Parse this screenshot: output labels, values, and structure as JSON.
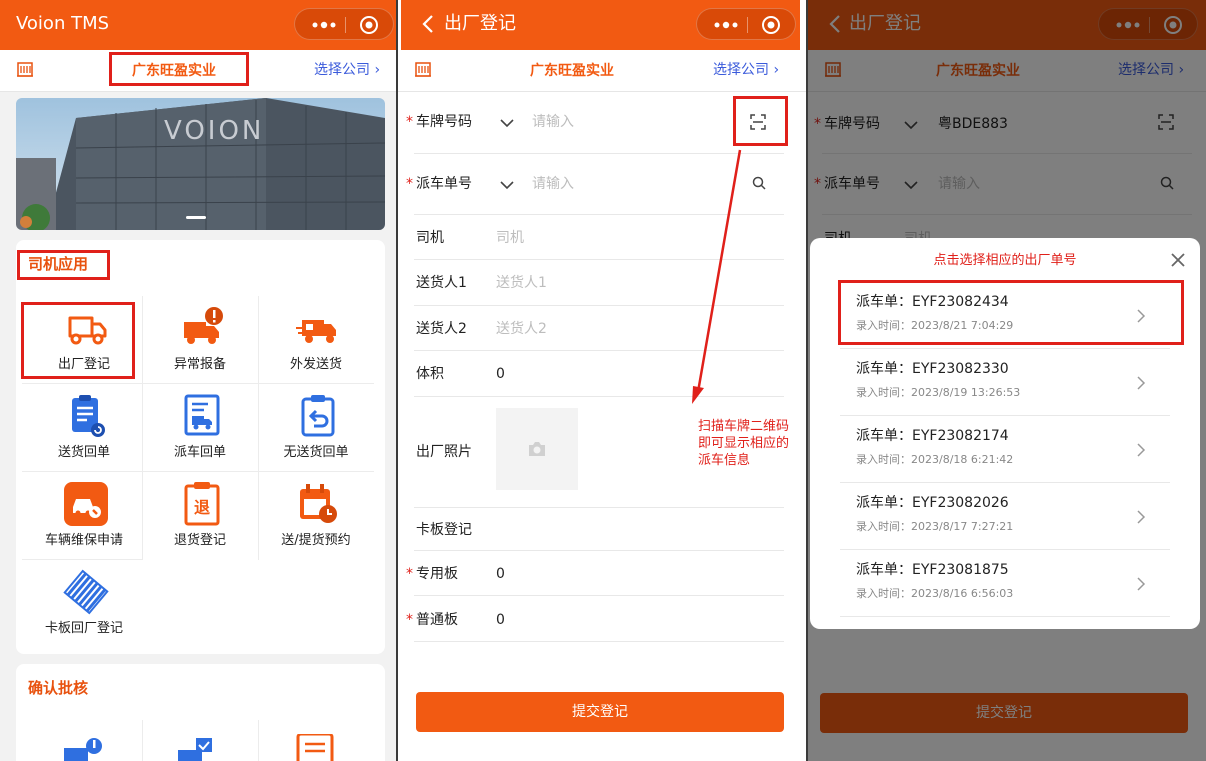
{
  "colors": {
    "brand": "#f25a12",
    "annotation": "#e0201a",
    "link": "#3b5bdb"
  },
  "screen1": {
    "app_title": "Voion TMS",
    "company": "广东旺盈实业",
    "select_company": "选择公司 ›",
    "banner_text": "VOION",
    "driver_section": "司机应用",
    "driver_apps": [
      {
        "label": "出厂登记",
        "icon": "truck-outline-icon"
      },
      {
        "label": "异常报备",
        "icon": "truck-alert-icon"
      },
      {
        "label": "外发送货",
        "icon": "truck-cargo-icon"
      },
      {
        "label": "送货回单",
        "icon": "clipboard-refresh-icon"
      },
      {
        "label": "派车回单",
        "icon": "document-truck-icon"
      },
      {
        "label": "无送货回单",
        "icon": "clipboard-return-icon"
      },
      {
        "label": "车辆维保申请",
        "icon": "car-repair-icon"
      },
      {
        "label": "退货登记",
        "icon": "return-document-icon"
      },
      {
        "label": "送/提货预约",
        "icon": "calendar-clock-icon"
      },
      {
        "label": "卡板回厂登记",
        "icon": "pallet-icon"
      }
    ],
    "confirm_section": "确认批核"
  },
  "screen2": {
    "title": "出厂登记",
    "company": "广东旺盈实业",
    "select_company": "选择公司 ›",
    "fields": {
      "plate": {
        "label": "车牌号码",
        "placeholder": "请输入"
      },
      "dispatch": {
        "label": "派车单号",
        "placeholder": "请输入"
      },
      "driver": {
        "label": "司机",
        "placeholder": "司机"
      },
      "sender1": {
        "label": "送货人1",
        "placeholder": "送货人1"
      },
      "sender2": {
        "label": "送货人2",
        "placeholder": "送货人2"
      },
      "volume": {
        "label": "体积",
        "value": "0"
      },
      "photo": {
        "label": "出厂照片"
      },
      "pallet_section": {
        "label": "卡板登记"
      },
      "special_pallet": {
        "label": "专用板",
        "value": "0"
      },
      "normal_pallet": {
        "label": "普通板",
        "value": "0"
      }
    },
    "submit": "提交登记",
    "annotation": [
      "扫描车牌二维码",
      "即可显示相应的",
      "派车信息"
    ]
  },
  "screen3": {
    "title": "出厂登记",
    "company": "广东旺盈实业",
    "select_company": "选择公司 ›",
    "plate_label": "车牌号码",
    "plate_value": "粤BDE883",
    "dispatch_label": "派车单号",
    "dispatch_placeholder": "请输入",
    "driver_label": "司机",
    "driver_placeholder": "司机",
    "popup_title": "点击选择相应的出厂单号",
    "submit": "提交登记",
    "orders": [
      {
        "no": "派车单：EYF23082434",
        "time": "录入时间：2023/8/21 7:04:29"
      },
      {
        "no": "派车单：EYF23082330",
        "time": "录入时间：2023/8/19 13:26:53"
      },
      {
        "no": "派车单：EYF23082174",
        "time": "录入时间：2023/8/18 6:21:42"
      },
      {
        "no": "派车单：EYF23082026",
        "time": "录入时间：2023/8/17 7:27:21"
      },
      {
        "no": "派车单：EYF23081875",
        "time": "录入时间：2023/8/16 6:56:03"
      }
    ]
  }
}
